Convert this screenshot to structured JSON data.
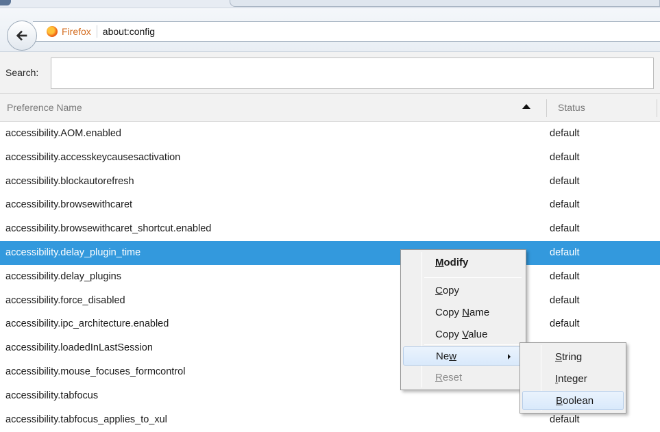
{
  "browser": {
    "brand_label": "Firefox",
    "url": "about:config",
    "icons": {
      "back": "back-arrow-icon",
      "brand": "firefox-logo-icon"
    }
  },
  "search": {
    "label": "Search:",
    "value": ""
  },
  "table": {
    "columns": {
      "name": "Preference Name",
      "status": "Status"
    },
    "sort": "ascending",
    "rows": [
      {
        "name": "accessibility.AOM.enabled",
        "status": "default"
      },
      {
        "name": "accessibility.accesskeycausesactivation",
        "status": "default"
      },
      {
        "name": "accessibility.blockautorefresh",
        "status": "default"
      },
      {
        "name": "accessibility.browsewithcaret",
        "status": "default"
      },
      {
        "name": "accessibility.browsewithcaret_shortcut.enabled",
        "status": "default"
      },
      {
        "name": "accessibility.delay_plugin_time",
        "status": "default"
      },
      {
        "name": "accessibility.delay_plugins",
        "status": "default"
      },
      {
        "name": "accessibility.force_disabled",
        "status": "default"
      },
      {
        "name": "accessibility.ipc_architecture.enabled",
        "status": "default"
      },
      {
        "name": "accessibility.loadedInLastSession",
        "status": ""
      },
      {
        "name": "accessibility.mouse_focuses_formcontrol",
        "status": ""
      },
      {
        "name": "accessibility.tabfocus",
        "status": ""
      },
      {
        "name": "accessibility.tabfocus_applies_to_xul",
        "status": "default"
      }
    ],
    "selected_index": 5
  },
  "context_menu": {
    "modify": "Modify",
    "copy": "Copy",
    "copy_name": "Copy Name",
    "copy_value": "Copy Value",
    "new": "New",
    "reset": "Reset"
  },
  "submenu": {
    "string": "String",
    "integer": "Integer",
    "boolean": "Boolean"
  },
  "colors": {
    "selection": "#3399dd",
    "brand": "#d36b1d"
  }
}
